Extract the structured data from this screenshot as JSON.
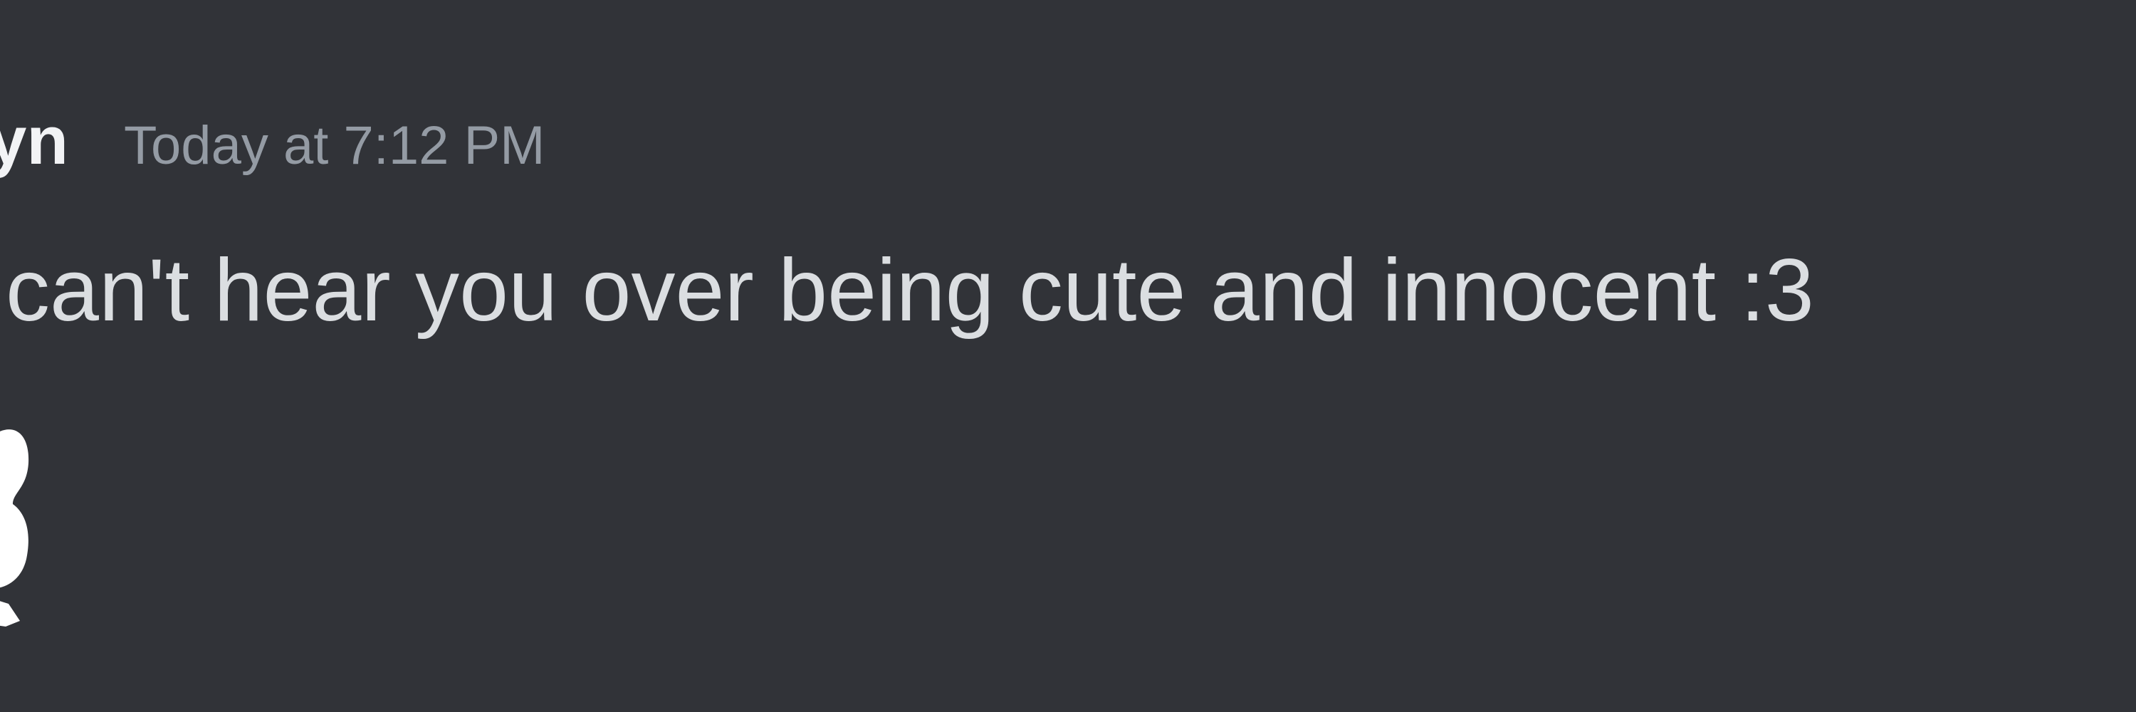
{
  "message": {
    "author": "yn",
    "timestamp": "Today at 7:12 PM",
    "content": "can't hear you over being cute and innocent :3",
    "attachment_icon": "emoji-sticker-icon"
  },
  "colors": {
    "background": "#313338",
    "author": "#f2f3f5",
    "timestamp": "#949ba4",
    "text": "#dbdee1"
  }
}
